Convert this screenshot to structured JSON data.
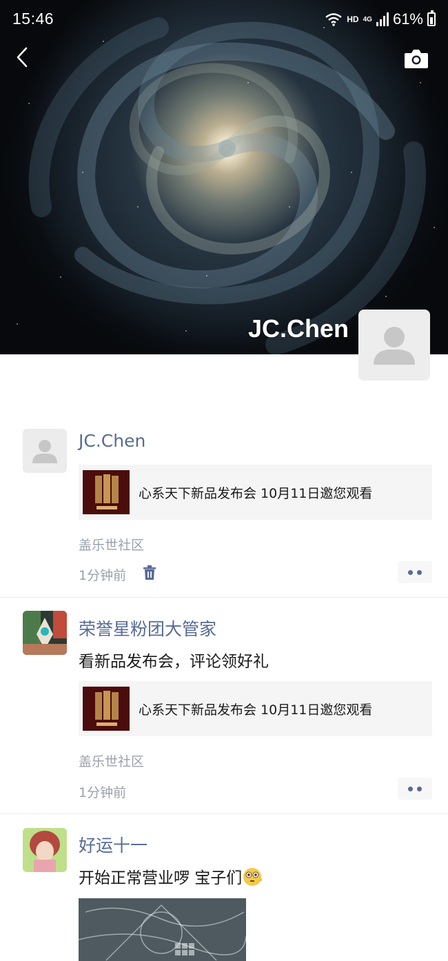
{
  "status_bar": {
    "time": "15:46",
    "hd_label": "HD",
    "network_label": "4G",
    "battery": "61%"
  },
  "profile": {
    "name": "JC.Chen"
  },
  "posts": [
    {
      "author": "JC.Chen",
      "text": "",
      "share_title": "心系天下新品发布会 10月11日邀您观看",
      "location": "盖乐世社区",
      "time": "1分钟前",
      "deletable": true
    },
    {
      "author": "荣誉星粉团大管家",
      "text": "看新品发布会，评论领好礼",
      "share_title": "心系天下新品发布会 10月11日邀您观看",
      "location": "盖乐世社区",
      "time": "1分钟前",
      "deletable": false
    },
    {
      "author": "好运十一",
      "text": "开始正常营业啰 宝子们",
      "emoji": "flushed-face-emoji"
    }
  ],
  "colors": {
    "link_blue": "#576b95",
    "meta_gray": "#9aa0ab",
    "card_bg": "#f5f5f5"
  }
}
